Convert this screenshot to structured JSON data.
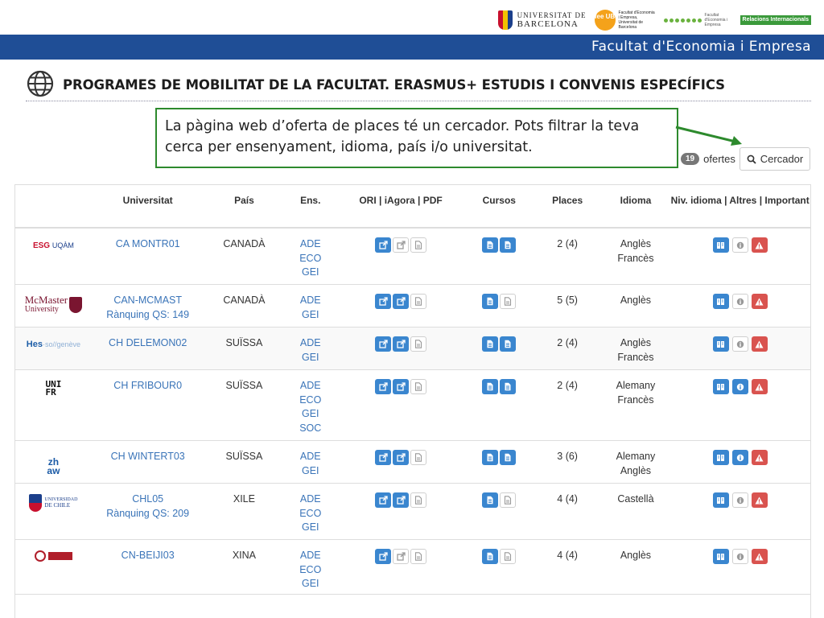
{
  "header": {
    "ub_logo": {
      "line1": "UNIVERSITAT DE",
      "line2": "BARCELONA"
    },
    "feeub_logo": {
      "mark": "fee UB",
      "text": "Facultat d'Economia i Empresa, Universitat de Barcelona"
    },
    "ri_logo": {
      "text": "Facultat d'Economia i Empresa",
      "badge": "Relacions Internacionals"
    },
    "faculty_name": "Facultat d'Economia i Empresa"
  },
  "page": {
    "title": "PROGRAMES DE MOBILITAT DE LA FACULTAT. ERASMUS+ ESTUDIS I CONVENIS ESPECÍFICS",
    "globe_icon": "globe-icon"
  },
  "callout": {
    "text": "La pàgina web d’oferta de places té un cercador. Pots filtrar la teva cerca per ensenyament, idioma, país i/o universitat."
  },
  "results": {
    "count": "19",
    "count_label": "ofertes"
  },
  "search": {
    "label": "Cercador",
    "icon": "search-icon"
  },
  "colors": {
    "brand_blue": "#1f4e96",
    "link_blue": "#3a74b8",
    "button_blue": "#3a86cf",
    "warning_red": "#d9534f",
    "callout_green": "#2d8a2d"
  },
  "table": {
    "headers": {
      "universitat": "Universitat",
      "pais": "País",
      "ens": "Ens.",
      "ori": "ORI | iAgora | PDF",
      "cursos": "Cursos",
      "places": "Places",
      "idioma": "Idioma",
      "niv": "Niv. idioma | Altres | Important"
    },
    "rows": [
      {
        "logo": {
          "a": "ESG",
          "b": "UQÀM"
        },
        "code": "CA MONTR01",
        "ranking": "",
        "pais": "CANADÀ",
        "ens": [
          "ADE",
          "ECO",
          "GEI"
        ],
        "places": "2 (4)",
        "idioma": [
          "Anglès",
          "Francès"
        ],
        "ori": [
          "blue",
          "grey",
          "grey"
        ],
        "cursos": [
          "blue",
          "blue"
        ],
        "niv": [
          "blue",
          "grey",
          "red"
        ]
      },
      {
        "logo": {
          "a": "McMaster",
          "b": "University"
        },
        "code": "CAN-MCMAST",
        "ranking": "Rànquing QS: 149",
        "pais": "CANADÀ",
        "ens": [
          "ADE",
          "GEI"
        ],
        "places": "5 (5)",
        "idioma": [
          "Anglès"
        ],
        "ori": [
          "blue",
          "blue",
          "grey"
        ],
        "cursos": [
          "blue",
          "grey"
        ],
        "niv": [
          "blue",
          "grey",
          "red"
        ]
      },
      {
        "logo": {
          "a": "Hes",
          "b": "·so//genève"
        },
        "code": "CH DELEMON02",
        "ranking": "",
        "pais": "SUÏSSA",
        "ens": [
          "ADE",
          "GEI"
        ],
        "places": "2 (4)",
        "idioma": [
          "Anglès",
          "Francès"
        ],
        "ori": [
          "blue",
          "blue",
          "grey"
        ],
        "cursos": [
          "blue",
          "blue"
        ],
        "niv": [
          "blue",
          "grey",
          "red"
        ]
      },
      {
        "logo": {
          "a": "UNI",
          "b": "FR"
        },
        "code": "CH FRIBOUR0",
        "ranking": "",
        "pais": "SUÏSSA",
        "ens": [
          "ADE",
          "ECO",
          "GEI",
          "SOC"
        ],
        "places": "2 (4)",
        "idioma": [
          "Alemany",
          "Francès"
        ],
        "ori": [
          "blue",
          "blue",
          "grey"
        ],
        "cursos": [
          "blue",
          "blue"
        ],
        "niv": [
          "blue",
          "blue",
          "red"
        ]
      },
      {
        "logo": {
          "a": "zh",
          "b": "aw"
        },
        "code": "CH WINTERT03",
        "ranking": "",
        "pais": "SUÏSSA",
        "ens": [
          "ADE",
          "GEI"
        ],
        "places": "3 (6)",
        "idioma": [
          "Alemany",
          "Anglès"
        ],
        "ori": [
          "blue",
          "blue",
          "grey"
        ],
        "cursos": [
          "blue",
          "blue"
        ],
        "niv": [
          "blue",
          "blue",
          "red"
        ]
      },
      {
        "logo": {
          "a": "UNIVERSIDAD",
          "b": "DE CHILE"
        },
        "code": "CHL05",
        "ranking": "Rànquing QS: 209",
        "pais": "XILE",
        "ens": [
          "ADE",
          "ECO",
          "GEI"
        ],
        "places": "4 (4)",
        "idioma": [
          "Castellà"
        ],
        "ori": [
          "blue",
          "blue",
          "grey"
        ],
        "cursos": [
          "blue",
          "grey"
        ],
        "niv": [
          "blue",
          "grey",
          "red"
        ]
      },
      {
        "logo": {
          "a": "",
          "b": ""
        },
        "code": "CN-BEIJI03",
        "ranking": "",
        "pais": "XINA",
        "ens": [
          "ADE",
          "ECO",
          "GEI"
        ],
        "places": "4 (4)",
        "idioma": [
          "Anglès"
        ],
        "ori": [
          "blue",
          "grey",
          "grey"
        ],
        "cursos": [
          "blue",
          "grey"
        ],
        "niv": [
          "blue",
          "grey",
          "red"
        ]
      }
    ]
  }
}
